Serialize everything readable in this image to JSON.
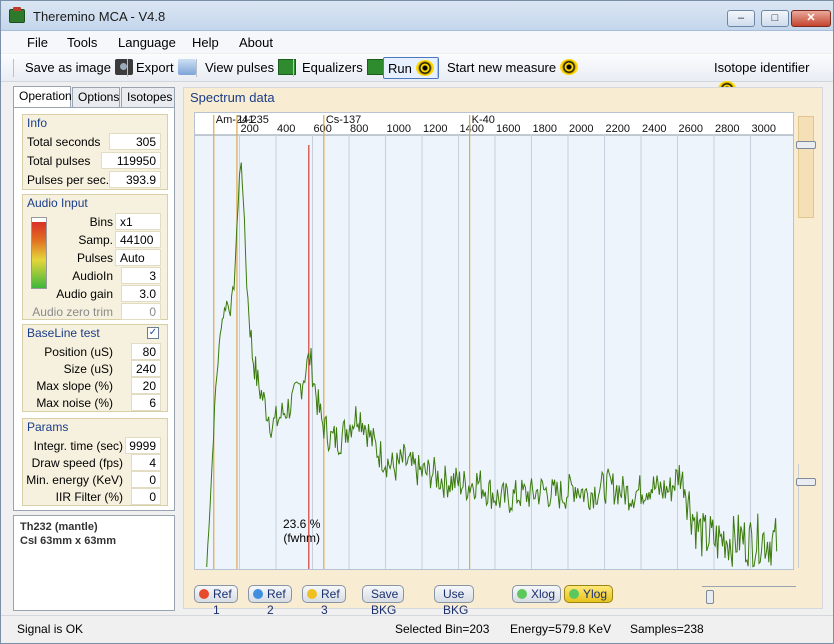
{
  "window": {
    "title": "Theremino MCA - V4.8"
  },
  "menu": [
    "File",
    "Tools",
    "Language",
    "Help",
    "About"
  ],
  "toolbar": {
    "save_image": "Save as image",
    "export": "Export",
    "view_pulses": "View pulses",
    "equalizers": "Equalizers",
    "run": "Run",
    "start_new_measure": "Start new measure",
    "isotope_identifier": "Isotope identifier"
  },
  "tabs": [
    "Operation",
    "Options",
    "Isotopes"
  ],
  "info": {
    "header": "Info",
    "total_seconds_label": "Total seconds",
    "total_seconds": "305",
    "total_pulses_label": "Total pulses",
    "total_pulses": "119950",
    "pps_label": "Pulses per sec.",
    "pps": "393.9"
  },
  "audio": {
    "header": "Audio Input",
    "bins_label": "Bins",
    "bins": "x1",
    "samp_label": "Samp.",
    "samp": "44100",
    "pulses_label": "Pulses",
    "pulses": "Auto",
    "audioin_label": "AudioIn",
    "audioin": "3",
    "gain_label": "Audio gain",
    "gain": "3.0",
    "zerotrim_label": "Audio zero trim",
    "zerotrim": "0",
    "level": 0.95
  },
  "baseline": {
    "header": "BaseLine test",
    "checked": true,
    "position_label": "Position (uS)",
    "position": "80",
    "size_label": "Size (uS)",
    "size": "240",
    "maxslope_label": "Max slope (%)",
    "maxslope": "20",
    "maxnoise_label": "Max noise (%)",
    "maxnoise": "6"
  },
  "params": {
    "header": "Params",
    "integr_label": "Integr. time (sec)",
    "integr": "9999",
    "drawspeed_label": "Draw speed (fps)",
    "drawspeed": "4",
    "minenergy_label": "Min. energy (KeV)",
    "minenergy": "0",
    "iir_label": "IIR Filter (%)",
    "iir": "0"
  },
  "description": [
    "Th232  (mantle)",
    "CsI 63mm x 63mm"
  ],
  "spectrum": {
    "title": "Spectrum data",
    "fwhm_value": "23.6 %",
    "fwhm_label": "(fwhm)",
    "buttons": {
      "ref1": "Ref 1",
      "ref2": "Ref 2",
      "ref3": "Ref 3",
      "save_bkg": "Save BKG",
      "use_bkg": "Use BKG",
      "xlog": "Xlog",
      "ylog": "Ylog"
    }
  },
  "status": {
    "signal": "Signal is OK",
    "bin": "Selected Bin=203",
    "energy": "Energy=579.8 KeV",
    "samples": "Samples=238"
  },
  "chart_data": {
    "type": "line",
    "title": "",
    "xlabel": "",
    "ylabel": "",
    "x_ticks": [
      200,
      400,
      600,
      800,
      1000,
      1200,
      1400,
      1600,
      1800,
      2000,
      2200,
      2400,
      2600,
      2800,
      3000
    ],
    "x_tick_labels": [
      "200",
      "400",
      "600",
      "800",
      "1000",
      "1200",
      "1400",
      "1600",
      "1800",
      "2000",
      "2200",
      "2400",
      "2600",
      "2800",
      "3000"
    ],
    "xlim": [
      0,
      3200
    ],
    "ylim": [
      0,
      1
    ],
    "yscale": "log",
    "grid": true,
    "isotope_markers": [
      {
        "label": "Am-241",
        "energy": 59,
        "color": "#e0a848"
      },
      {
        "label": "U-235",
        "energy": 186,
        "color": "#e0a848"
      },
      {
        "label": "Cs-137",
        "energy": 662,
        "color": "#e0a848"
      },
      {
        "label": "K-40",
        "energy": 1461,
        "color": "#e0a848"
      }
    ],
    "cursor_energy": 579.8,
    "series": [
      {
        "color": "#3a7a0c",
        "points": [
          [
            20,
            0.0
          ],
          [
            45,
            0.2
          ],
          [
            70,
            0.42
          ],
          [
            100,
            0.57
          ],
          [
            130,
            0.62
          ],
          [
            150,
            0.6
          ],
          [
            170,
            0.66
          ],
          [
            185,
            0.78
          ],
          [
            200,
            0.92
          ],
          [
            210,
            0.94
          ],
          [
            220,
            0.87
          ],
          [
            240,
            0.66
          ],
          [
            270,
            0.5
          ],
          [
            300,
            0.43
          ],
          [
            340,
            0.38
          ],
          [
            380,
            0.33
          ],
          [
            420,
            0.35
          ],
          [
            460,
            0.37
          ],
          [
            500,
            0.39
          ],
          [
            540,
            0.43
          ],
          [
            570,
            0.47
          ],
          [
            585,
            0.49
          ],
          [
            600,
            0.46
          ],
          [
            620,
            0.4
          ],
          [
            650,
            0.34
          ],
          [
            700,
            0.3
          ],
          [
            750,
            0.3
          ],
          [
            800,
            0.33
          ],
          [
            850,
            0.36
          ],
          [
            880,
            0.34
          ],
          [
            920,
            0.3
          ],
          [
            960,
            0.27
          ],
          [
            1000,
            0.25
          ],
          [
            1050,
            0.23
          ],
          [
            1100,
            0.25
          ],
          [
            1150,
            0.23
          ],
          [
            1200,
            0.22
          ],
          [
            1260,
            0.22
          ],
          [
            1320,
            0.2
          ],
          [
            1380,
            0.2
          ],
          [
            1450,
            0.19
          ],
          [
            1500,
            0.2
          ],
          [
            1560,
            0.18
          ],
          [
            1620,
            0.16
          ],
          [
            1680,
            0.16
          ],
          [
            1740,
            0.17
          ],
          [
            1800,
            0.17
          ],
          [
            1860,
            0.18
          ],
          [
            1920,
            0.17
          ],
          [
            1980,
            0.17
          ],
          [
            2040,
            0.19
          ],
          [
            2100,
            0.17
          ],
          [
            2160,
            0.18
          ],
          [
            2220,
            0.19
          ],
          [
            2280,
            0.18
          ],
          [
            2340,
            0.17
          ],
          [
            2400,
            0.18
          ],
          [
            2450,
            0.19
          ],
          [
            2500,
            0.18
          ],
          [
            2560,
            0.18
          ],
          [
            2610,
            0.22
          ],
          [
            2640,
            0.19
          ],
          [
            2670,
            0.14
          ],
          [
            2700,
            0.1
          ],
          [
            2740,
            0.07
          ],
          [
            2780,
            0.07
          ],
          [
            2820,
            0.06
          ],
          [
            2860,
            0.07
          ],
          [
            2900,
            0.06
          ],
          [
            2940,
            0.07
          ],
          [
            2980,
            0.06
          ],
          [
            3020,
            0.06
          ],
          [
            3060,
            0.07
          ],
          [
            3100,
            0.06
          ],
          [
            3150,
            0.06
          ]
        ]
      }
    ]
  }
}
